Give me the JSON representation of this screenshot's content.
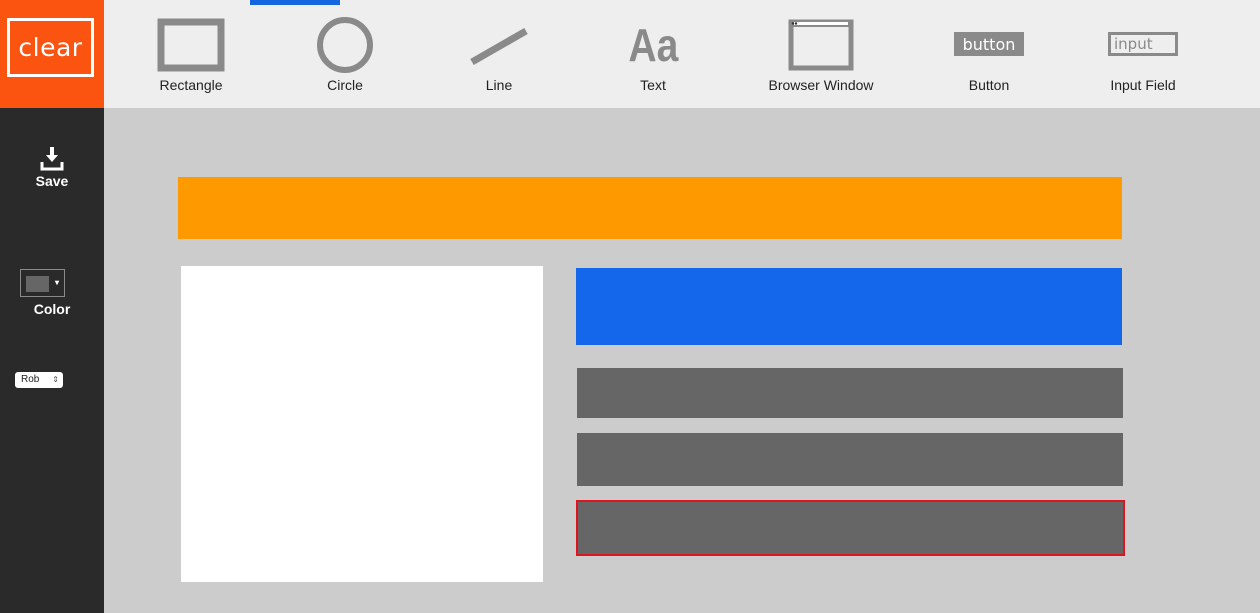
{
  "logo": {
    "text": "clear",
    "color": "#fb5310"
  },
  "toolbar": {
    "active_tool": "Rectangle",
    "active_color": "#1565e0",
    "tools": [
      {
        "label": "Rectangle",
        "icon": "rectangle-icon"
      },
      {
        "label": "Circle",
        "icon": "circle-icon"
      },
      {
        "label": "Line",
        "icon": "line-icon"
      },
      {
        "label": "Text",
        "icon": "text-icon",
        "glyph": "Aa"
      },
      {
        "label": "Browser Window",
        "icon": "browser-window-icon"
      },
      {
        "label": "Button",
        "icon": "button-icon",
        "glyph": "button"
      },
      {
        "label": "Input Field",
        "icon": "input-field-icon",
        "glyph": "input"
      }
    ]
  },
  "sidebar": {
    "save_label": "Save",
    "save_icon": "download-icon",
    "color_label": "Color",
    "color_value": "#666666",
    "color_arrow": "▾",
    "font_value": "Rob",
    "font_arrow": "⇕"
  },
  "canvas": {
    "background": "#cccccc",
    "shapes": [
      {
        "type": "rectangle",
        "fill": "#ff9900",
        "selected": false
      },
      {
        "type": "rectangle",
        "fill": "#ffffff",
        "selected": false
      },
      {
        "type": "rectangle",
        "fill": "#1467ea",
        "selected": false
      },
      {
        "type": "rectangle",
        "fill": "#666666",
        "selected": false
      },
      {
        "type": "rectangle",
        "fill": "#666666",
        "selected": false
      },
      {
        "type": "rectangle",
        "fill": "#666666",
        "selected": true,
        "border": "#e0141e"
      }
    ]
  }
}
